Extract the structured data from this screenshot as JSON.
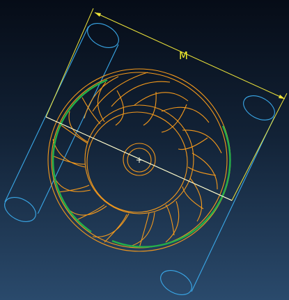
{
  "viewport": {
    "dimension_label": "M"
  },
  "colors": {
    "dimension": "#f0e63a",
    "shaft": "#3aa8e8",
    "part_edge": "#f59a1c",
    "highlight_edge": "#23b04a",
    "axis": "#fffde0"
  },
  "icons": {
    "origin": "crosshair-icon"
  }
}
